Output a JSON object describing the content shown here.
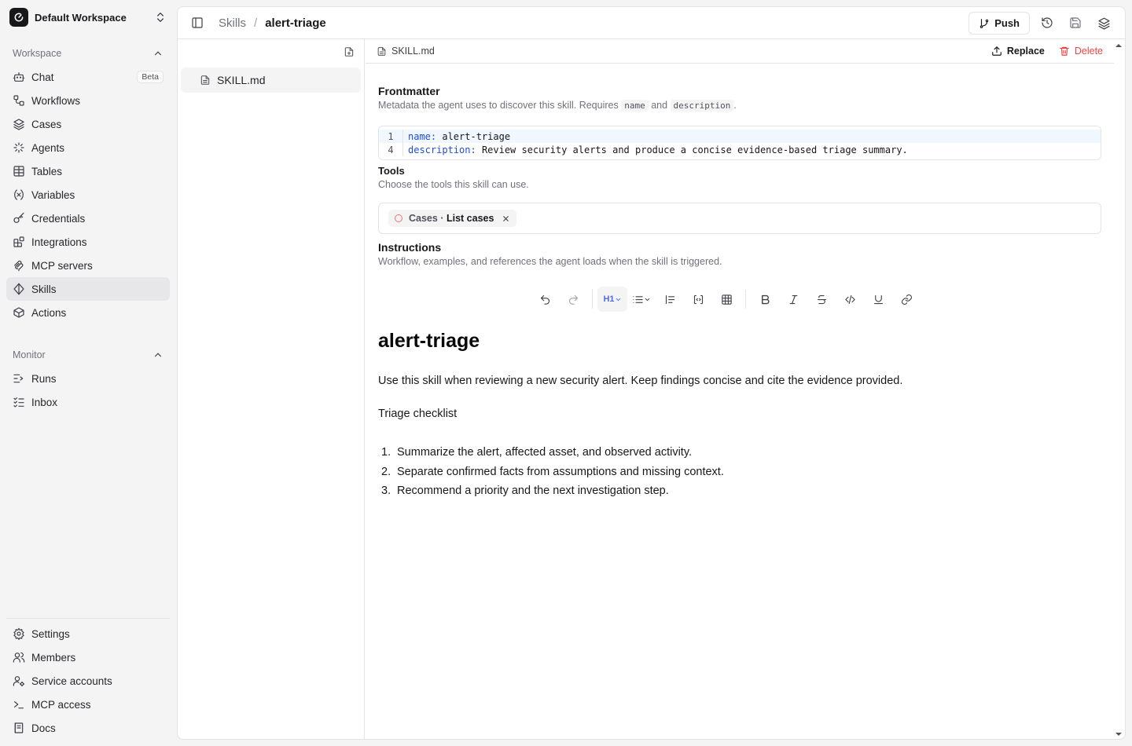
{
  "workspace": {
    "name": "Default Workspace"
  },
  "sidebar": {
    "workspace_group": "Workspace",
    "workspace_items": [
      {
        "label": "Chat",
        "icon": "bot-icon",
        "badge": "Beta"
      },
      {
        "label": "Workflows",
        "icon": "workflow-icon"
      },
      {
        "label": "Cases",
        "icon": "layers-icon"
      },
      {
        "label": "Agents",
        "icon": "sparkle-icon"
      },
      {
        "label": "Tables",
        "icon": "table-icon"
      },
      {
        "label": "Variables",
        "icon": "variable-icon"
      },
      {
        "label": "Credentials",
        "icon": "key-icon"
      },
      {
        "label": "Integrations",
        "icon": "blocks-icon"
      },
      {
        "label": "MCP servers",
        "icon": "mcp-icon"
      },
      {
        "label": "Skills",
        "icon": "skill-icon",
        "active": true
      },
      {
        "label": "Actions",
        "icon": "box-icon"
      }
    ],
    "monitor_group": "Monitor",
    "monitor_items": [
      {
        "label": "Runs",
        "icon": "runs-icon"
      },
      {
        "label": "Inbox",
        "icon": "inbox-icon"
      }
    ],
    "bottom_items": [
      {
        "label": "Settings",
        "icon": "gear-icon"
      },
      {
        "label": "Members",
        "icon": "users-icon"
      },
      {
        "label": "Service accounts",
        "icon": "user-cog-icon"
      },
      {
        "label": "MCP access",
        "icon": "terminal-icon"
      },
      {
        "label": "Docs",
        "icon": "book-icon"
      }
    ]
  },
  "header": {
    "breadcrumb_parent": "Skills",
    "breadcrumb_separator": "/",
    "breadcrumb_current": "alert-triage",
    "push_label": "Push"
  },
  "files": {
    "items": [
      "SKILL.md"
    ]
  },
  "editor": {
    "filename": "SKILL.md",
    "replace_label": "Replace",
    "delete_label": "Delete",
    "frontmatter": {
      "title": "Frontmatter",
      "desc_prefix": "Metadata the agent uses to discover this skill. Requires",
      "desc_code1": "name",
      "desc_and": "and",
      "desc_code2": "description",
      "desc_suffix": ".",
      "lines": [
        {
          "num": "1",
          "key": "name:",
          "value": "alert-triage"
        },
        {
          "num": "4",
          "key": "description:",
          "value": "Review security alerts and produce a concise evidence-based triage summary."
        }
      ]
    },
    "tools": {
      "title": "Tools",
      "desc": "Choose the tools this skill can use.",
      "chip_category": "Cases",
      "chip_dot": "·",
      "chip_name": "List cases"
    },
    "instructions": {
      "title": "Instructions",
      "desc": "Workflow, examples, and references the agent loads when the skill is triggered.",
      "heading_button": "H1"
    },
    "document": {
      "heading": "alert-triage",
      "paragraph": "Use this skill when reviewing a new security alert. Keep findings concise and cite the evidence provided.",
      "subheading": "Triage checklist",
      "list": [
        {
          "num": "1.",
          "text": "Summarize the alert, affected asset, and observed activity."
        },
        {
          "num": "2.",
          "text": "Separate confirmed facts from assumptions and missing context."
        },
        {
          "num": "3.",
          "text": "Recommend a priority and the next investigation step."
        }
      ]
    }
  },
  "colors": {
    "accent": "#4f6bed",
    "danger": "#ef4444",
    "code_key": "#1d4ed8"
  }
}
